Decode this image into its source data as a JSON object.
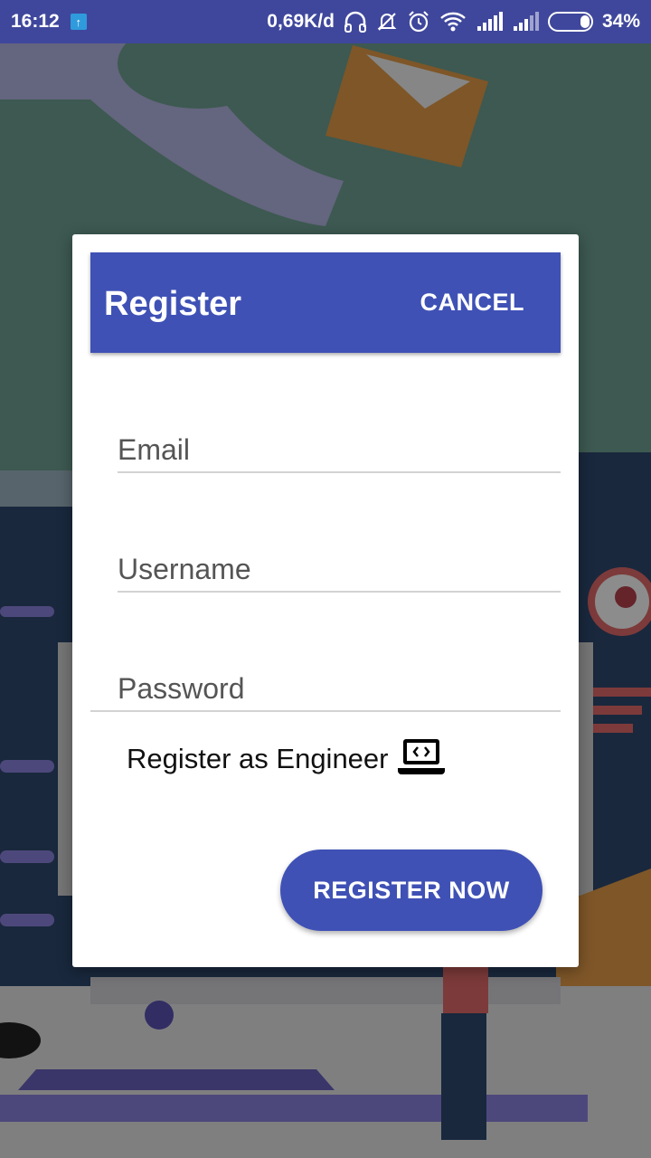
{
  "status_bar": {
    "time": "16:12",
    "data_rate": "0,69K/d",
    "battery_percent": "34%",
    "icons": [
      "upload-icon",
      "headphones-icon",
      "bell-off-icon",
      "alarm-icon",
      "wifi-icon",
      "signal-icon",
      "signal-icon",
      "battery-icon"
    ]
  },
  "dialog": {
    "title": "Register",
    "cancel_label": "CANCEL",
    "email_placeholder": "Email",
    "username_placeholder": "Username",
    "password_placeholder": "Password",
    "engineer_label": "Register as Engineer",
    "engineer_icon": "laptop-code-icon",
    "submit_label": "REGISTER NOW"
  },
  "colors": {
    "status_bar": "#3f479c",
    "primary": "#3f51b5",
    "background_teal": "#5e8076"
  }
}
